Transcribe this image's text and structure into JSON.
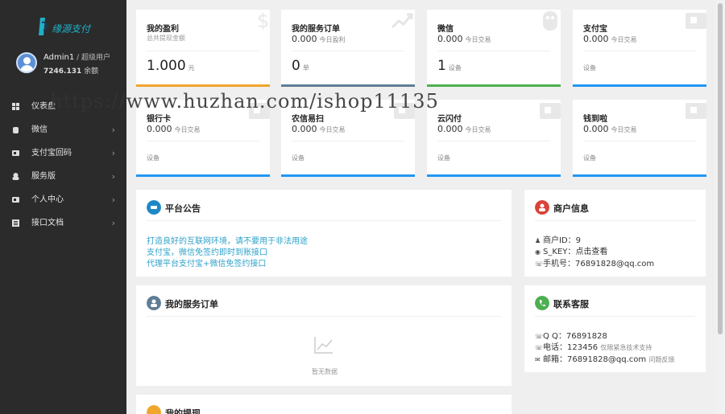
{
  "brand": {
    "name": "缘源支付",
    "colors": {
      "teal": "#1fb0c8",
      "dark": "#1a3a5a"
    }
  },
  "user": {
    "name": "Admin1",
    "role": " / 超级用户",
    "balance": "7246.131",
    "balance_label": "余额"
  },
  "menu": [
    {
      "label": "仪表盘",
      "icon": "dashboard-icon",
      "chevron": ""
    },
    {
      "label": "微信",
      "icon": "wechat-icon",
      "chevron": "›"
    },
    {
      "label": "支付宝回码",
      "icon": "alipay-icon",
      "chevron": "›"
    },
    {
      "label": "服务版",
      "icon": "service-icon",
      "chevron": "›"
    },
    {
      "label": "个人中心",
      "icon": "user-center-icon",
      "chevron": "›"
    },
    {
      "label": "接口文档",
      "icon": "api-doc-icon",
      "chevron": "›"
    }
  ],
  "watermark": "https://www.huzhan.com/ishop11135",
  "cards": [
    {
      "title": "我的盈利",
      "sub": "总共提现金额",
      "sub_suffix": "",
      "value": "1.000",
      "unit": "元",
      "foot": "",
      "bar_color": "#f0a52d",
      "icon": "dollar-icon"
    },
    {
      "title": "我的服务订单",
      "sub": "0.000",
      "sub_suffix": "今日盈利",
      "value": "0",
      "unit": "单",
      "foot": "",
      "bar_color": "#5f7d95",
      "icon": "trend-icon"
    },
    {
      "title": "微信",
      "sub": "0.000",
      "sub_suffix": "今日交易",
      "value": "1",
      "unit": "设备",
      "foot": "",
      "bar_color": "#4caf50",
      "icon": "wechat-icon"
    },
    {
      "title": "支付宝",
      "sub": "0.000",
      "sub_suffix": "今日交易",
      "value": "",
      "unit": "",
      "foot": "设备",
      "bar_color": "#2196f3",
      "icon": "alipay-icon"
    },
    {
      "title": "银行卡",
      "sub": "0.000",
      "sub_suffix": "今日交易",
      "value": "",
      "unit": "",
      "foot": "设备",
      "bar_color": "#2196f3",
      "icon": "bank-icon"
    },
    {
      "title": "农信易扫",
      "sub": "0.000",
      "sub_suffix": "今日交易",
      "value": "",
      "unit": "",
      "foot": "设备",
      "bar_color": "#2196f3",
      "icon": "bank-icon"
    },
    {
      "title": "云闪付",
      "sub": "0.000",
      "sub_suffix": "今日交易",
      "value": "",
      "unit": "",
      "foot": "设备",
      "bar_color": "#2196f3",
      "icon": "bank-icon"
    },
    {
      "title": "钱到啦",
      "sub": "0.000",
      "sub_suffix": "今日交易",
      "value": "",
      "unit": "",
      "foot": "设备",
      "bar_color": "#2196f3",
      "icon": "bank-icon"
    }
  ],
  "notice": {
    "title": "平台公告",
    "lines": [
      "打造良好的互联网环境，请不要用于非法用途",
      "支付宝，微信免签约即时到账接口",
      "代理平台支付宝+微信免签约接口"
    ]
  },
  "merchant": {
    "title": "商户信息",
    "id_label": "商户ID：",
    "id_value": "9",
    "key_label": "S_KEY：",
    "key_value": "点击查看",
    "phone_label": "手机号：",
    "phone_value": "76891828@qq.com"
  },
  "orders": {
    "title": "我的服务订单",
    "empty": "暂无数据"
  },
  "support": {
    "title": "联系客服",
    "qq_label": "Q Q：",
    "qq_value": "76891828",
    "tel_label": "电话：",
    "tel_value": "123456",
    "tel_note": "仅限紧急技术支持",
    "mail_label": "邮箱：",
    "mail_value": "76891828@qq.com",
    "mail_note": "问题反馈"
  },
  "withdraw": {
    "title": "我的提现"
  }
}
